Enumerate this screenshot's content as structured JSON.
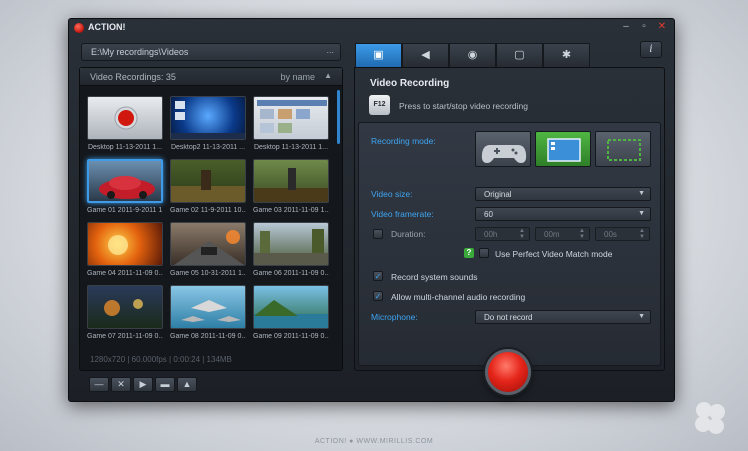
{
  "window": {
    "title": "ACTION!",
    "info_label": "i"
  },
  "path_bar": {
    "path": "E:\\My recordings\\Videos",
    "more": "..."
  },
  "recordings": {
    "title": "Video Recordings: 35",
    "sort_label": "by name",
    "items": [
      {
        "caption": "Desktop 11-13-2011 1..."
      },
      {
        "caption": "Desktop2 11-13-2011 ..."
      },
      {
        "caption": "Desktop 11-13-2011 1..."
      },
      {
        "caption": "Game 01 2011-9-2011 1..."
      },
      {
        "caption": "Game 02 11-9-2011 10..."
      },
      {
        "caption": "Game 03 2011-11-09 1..."
      },
      {
        "caption": "Game 04 2011-11-09 0..."
      },
      {
        "caption": "Game 05 10-31-2011 1..."
      },
      {
        "caption": "Game 06 2011-11-09 0..."
      },
      {
        "caption": "Game 07 2011-11-09 0..."
      },
      {
        "caption": "Game 08 2011-11-09 0..."
      },
      {
        "caption": "Game 09 2011-11-09 0..."
      }
    ],
    "footer": "1280x720 | 60.000fps | 0:00:24 | 134MB"
  },
  "controls": [
    "—",
    "✕",
    "▶",
    "▬",
    "▲"
  ],
  "tabs": [
    "▣",
    "◀",
    "◉",
    "▢",
    "✱"
  ],
  "video_recording": {
    "title": "Video Recording",
    "hotkey": "F12",
    "hotkey_hint": "Press to start/stop video recording",
    "recording_mode_label": "Recording mode:",
    "video_size_label": "Video size:",
    "video_size_value": "Original",
    "framerate_label": "Video framerate:",
    "framerate_value": "60",
    "duration_label": "Duration:",
    "duration_h": "00h",
    "duration_m": "00m",
    "duration_s": "00s",
    "help_mark": "?",
    "perfect_match_label": "Use Perfect Video Match mode",
    "system_sounds_label": "Record system sounds",
    "system_sounds_checked": true,
    "multichannel_label": "Allow multi-channel audio recording",
    "multichannel_checked": true,
    "microphone_label": "Microphone:",
    "microphone_value": "Do not record"
  },
  "footer": {
    "text": "ACTION!  ●  WWW.MIRILLIS.COM"
  },
  "colors": {
    "accent": "#3d9be9",
    "record_red": "#e5251a",
    "mode_active": "#4fb642"
  }
}
